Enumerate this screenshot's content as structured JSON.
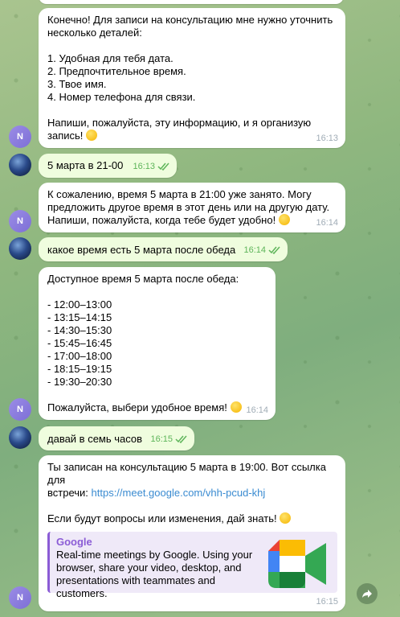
{
  "messages": [
    {
      "id": "m1",
      "text": "Конечно! Для записи на консультацию мне нужно уточнить\nнесколько деталей:\n\n1. Удобная для тебя дата.\n2. Предпочтительное время.\n3. Твое имя.\n4. Номер телефона для связи.\n\nНапиши, пожалуйста, эту информацию, и я организую\nзапись!",
      "time": "16:13"
    },
    {
      "id": "m2",
      "text": "5 марта в 21-00",
      "time": "16:13"
    },
    {
      "id": "m3",
      "text": "К сожалению, время 5 марта в 21:00 уже занято. Могу\nпредложить другое время в этот день или на другую дату.\nНапиши, пожалуйста, когда тебе будет удобно!",
      "time": "16:14"
    },
    {
      "id": "m4",
      "text": "какое время есть  5 марта после обеда",
      "time": "16:14"
    },
    {
      "id": "m5",
      "text": "Доступное время 5 марта после обеда:\n\n- 12:00–13:00\n- 13:15–14:15\n- 14:30–15:30\n- 15:45–16:45\n- 17:00–18:00\n- 18:15–19:15\n- 19:30–20:30\n\nПожалуйста, выбери удобное время!",
      "time": "16:14"
    },
    {
      "id": "m6",
      "text": "давай в семь часов",
      "time": "16:15"
    },
    {
      "id": "m7",
      "text_before": "Ты записан на консультацию 5 марта в 19:00. Вот ссылка для\nвстречи: ",
      "link": "https://meet.google.com/vhh-pcud-khj",
      "text_after": "\n\nЕсли будут вопросы или изменения, дай знать!",
      "preview_site": "Google",
      "preview_desc": "Real-time meetings by Google. Using your browser, share your video, desktop, and presentations with teammates and customers.",
      "time": "16:15"
    }
  ],
  "avatar_initial": "N",
  "icons": {
    "emoji": "smiling-face-icon",
    "read": "double-check-icon",
    "share": "share-arrow-icon",
    "logo": "google-meet-icon"
  },
  "colors": {
    "incoming": "#ffffff",
    "outgoing": "#effdde",
    "link": "#3a8bd1",
    "preview_accent": "#8b5cd6"
  }
}
